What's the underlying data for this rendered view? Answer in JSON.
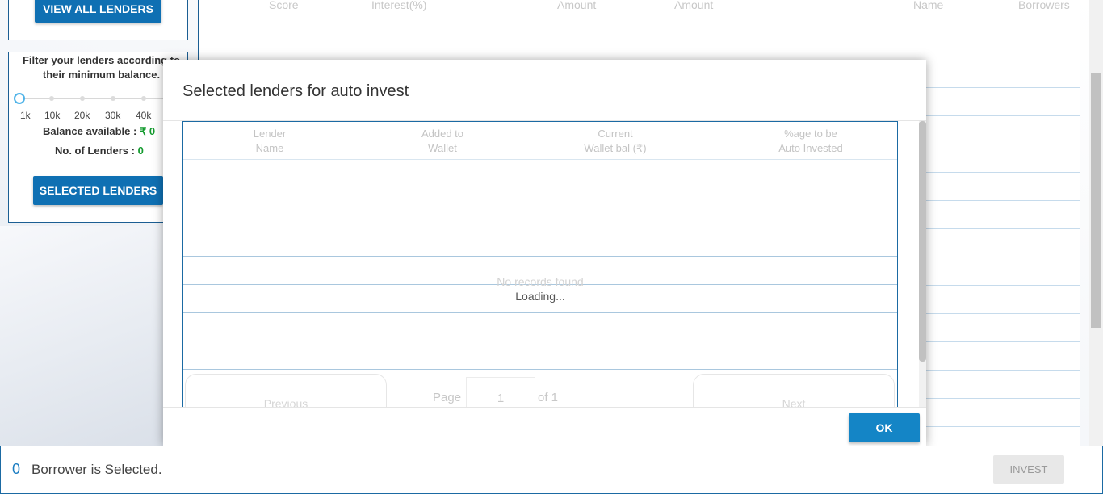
{
  "sidebar": {
    "view_all_label": "VIEW ALL LENDERS",
    "filter_text": "Filter your lenders according to their minimum balance.",
    "slider_ticks": [
      "1k",
      "10k",
      "20k",
      "30k",
      "40k"
    ],
    "balance_label": "Balance available :",
    "balance_value": "₹ 0",
    "lenders_label": "No. of Lenders :",
    "lenders_value": "0",
    "selected_lenders_label": "SELECTED LENDERS"
  },
  "background_table": {
    "headers": [
      "Score",
      "Interest(%)",
      "Amount",
      "Amount",
      "Name",
      "Borrowers"
    ]
  },
  "modal": {
    "title": "Selected lenders for auto invest",
    "columns": [
      {
        "line1": "Lender",
        "line2": "Name"
      },
      {
        "line1": "Added to",
        "line2": "Wallet"
      },
      {
        "line1": "Current",
        "line2": "Wallet bal (₹)"
      },
      {
        "line1": "%age to be",
        "line2": "Auto Invested"
      }
    ],
    "no_records": "No records found",
    "loading": "Loading...",
    "pager": {
      "previous": "Previous",
      "next": "Next",
      "page_label": "Page",
      "page_value": "1",
      "of_label": "of 1"
    },
    "ok_label": "OK"
  },
  "bottom_bar": {
    "count": "0",
    "text": "Borrower is Selected.",
    "invest_label": "INVEST"
  },
  "colors": {
    "primary": "#0f70b3",
    "ok_button": "#1485c6",
    "border": "#1b6aa3",
    "green": "#129a2d"
  }
}
